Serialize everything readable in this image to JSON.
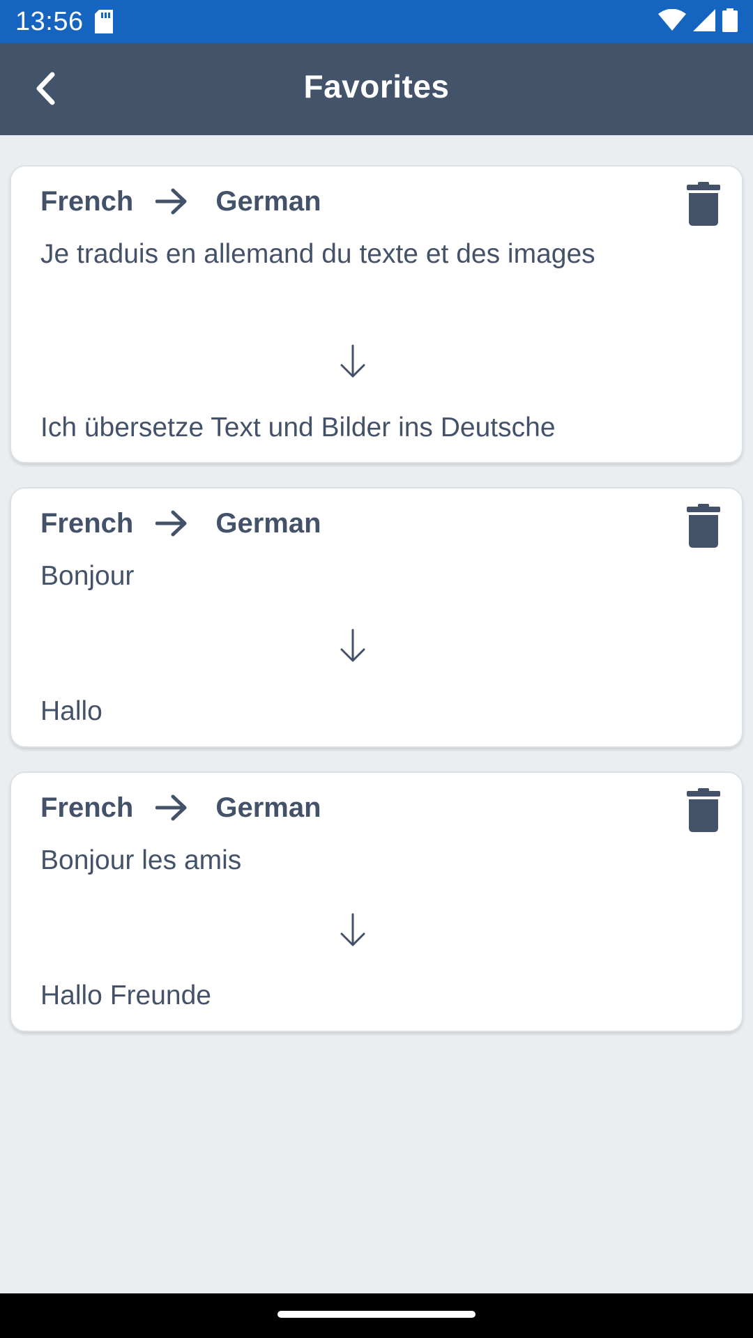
{
  "status_bar": {
    "time": "13:56",
    "icons": [
      "sd-card-icon",
      "wifi-icon",
      "signal-icon",
      "battery-icon"
    ]
  },
  "header": {
    "title": "Favorites",
    "back_icon": "chevron-left-icon"
  },
  "favorites": [
    {
      "source_lang": "French",
      "target_lang": "German",
      "source_text": "Je traduis en allemand du texte et des images",
      "target_text": "Ich übersetze Text und Bilder ins Deutsche"
    },
    {
      "source_lang": "French",
      "target_lang": "German",
      "source_text": "Bonjour",
      "target_text": "Hallo"
    },
    {
      "source_lang": "French",
      "target_lang": "German",
      "source_text": "Bonjour les amis",
      "target_text": "Hallo Freunde"
    }
  ],
  "colors": {
    "status_bar": "#1565c0",
    "app_bar": "#42536a",
    "background": "#ebeef1",
    "card": "#ffffff",
    "text": "#435268"
  }
}
